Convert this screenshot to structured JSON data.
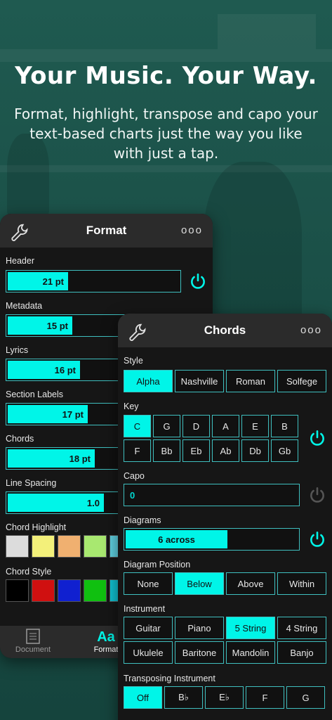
{
  "hero": {
    "title": "Your Music. Your Way.",
    "subtitle": "Format, highlight, transpose and capo your text-based charts just the way you like with just a tap."
  },
  "colors": {
    "accent": "#00f5e8",
    "border": "#3fbfbf",
    "power_off": "#555555"
  },
  "format_panel": {
    "title": "Format",
    "more": "ooo",
    "header_label": "Header",
    "header_value": "21 pt",
    "metadata_label": "Metadata",
    "metadata_value": "15 pt",
    "lyrics_label": "Lyrics",
    "lyrics_value": "16 pt",
    "section_label": "Section Labels",
    "section_value": "17 pt",
    "chords_label": "Chords",
    "chords_value": "18 pt",
    "spacing_label": "Line Spacing",
    "spacing_value": "1.0",
    "highlight_label": "Chord Highlight",
    "style_label": "Chord Style",
    "highlight_swatches": [
      "#dcdcdc",
      "#f3f07a",
      "#f0b070",
      "#a8e870",
      "#5fd0e0"
    ],
    "style_swatches": [
      "#000000",
      "#d01010",
      "#1020d0",
      "#10c010",
      "#10c0d0"
    ],
    "tabs": {
      "document": "Document",
      "format": "Format",
      "format_icon": "Aa"
    }
  },
  "chords_panel": {
    "title": "Chords",
    "more": "ooo",
    "style_label": "Style",
    "styles": [
      "Alpha",
      "Nashville",
      "Roman",
      "Solfege"
    ],
    "key_label": "Key",
    "keys_row1": [
      "C",
      "G",
      "D",
      "A",
      "E",
      "B"
    ],
    "keys_row2": [
      "F",
      "Bb",
      "Eb",
      "Ab",
      "Db",
      "Gb"
    ],
    "capo_label": "Capo",
    "capo_value": "0",
    "diagrams_label": "Diagrams",
    "diagrams_value": "6 across",
    "position_label": "Diagram Position",
    "positions": [
      "None",
      "Below",
      "Above",
      "Within"
    ],
    "instrument_label": "Instrument",
    "instruments_row1": [
      "Guitar",
      "Piano",
      "5 String",
      "4 String"
    ],
    "instruments_row2": [
      "Ukulele",
      "Baritone",
      "Mandolin",
      "Banjo"
    ],
    "transposing_label": "Transposing Instrument",
    "transposing": [
      "Off",
      "B♭",
      "E♭",
      "F",
      "G"
    ]
  }
}
